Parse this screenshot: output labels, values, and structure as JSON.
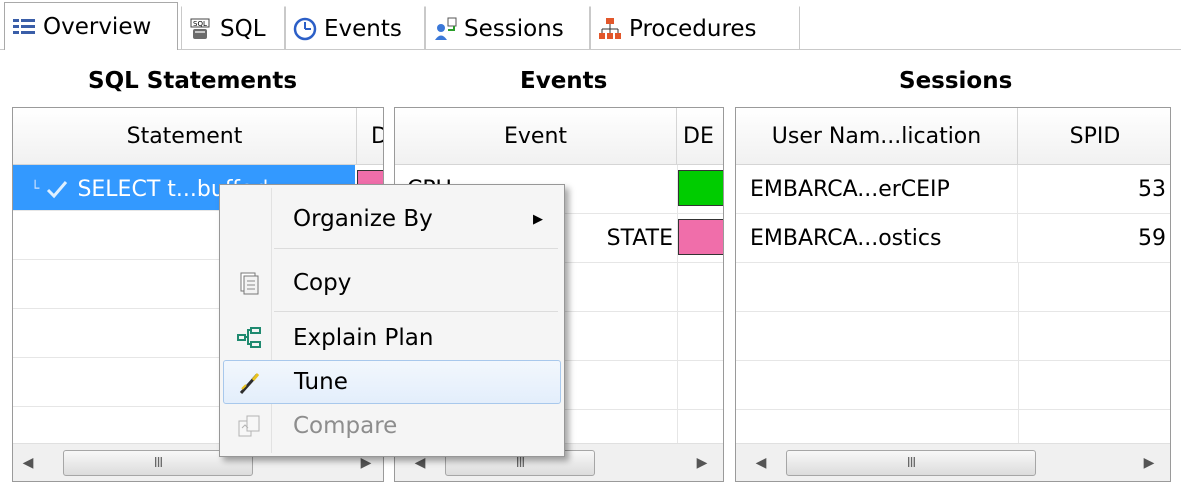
{
  "tabs": [
    {
      "label": "Overview",
      "icon": "overview-icon"
    },
    {
      "label": "SQL",
      "icon": "sql-icon"
    },
    {
      "label": "Events",
      "icon": "events-clock-icon"
    },
    {
      "label": "Sessions",
      "icon": "sessions-icon"
    },
    {
      "label": "Procedures",
      "icon": "procedures-icon"
    }
  ],
  "headings": {
    "sql": "SQL Statements",
    "events": "Events",
    "sessions": "Sessions"
  },
  "sql_panel": {
    "columns": [
      "Statement",
      "D"
    ],
    "rows": [
      {
        "statement": "SELECT t...buffer'",
        "swatch_color": "#f06eaa"
      }
    ]
  },
  "events_panel": {
    "columns": [
      "Event",
      "DE"
    ],
    "rows": [
      {
        "event": "CPU",
        "swatch_color": "#00cc00"
      },
      {
        "event": "STATE",
        "swatch_color": "#f06eaa"
      }
    ]
  },
  "sessions_panel": {
    "columns": [
      "User Nam...lication",
      "SPID"
    ],
    "rows": [
      {
        "user": "EMBARCA...erCEIP",
        "spid": "53"
      },
      {
        "user": "EMBARCA...ostics",
        "spid": "59"
      }
    ]
  },
  "scrollbar": {
    "grip": "III"
  },
  "context_menu": {
    "items": [
      {
        "label": "Organize By",
        "icon": "",
        "submenu": true
      },
      {
        "label": "Copy",
        "icon": "copy-icon"
      },
      {
        "label": "Explain Plan",
        "icon": "explain-plan-icon"
      },
      {
        "label": "Tune",
        "icon": "tune-wand-icon"
      },
      {
        "label": "Compare",
        "icon": "compare-icon",
        "disabled": true
      }
    ]
  },
  "colors": {
    "selection": "#3399ff",
    "pink": "#f06eaa",
    "green": "#00cc00"
  }
}
